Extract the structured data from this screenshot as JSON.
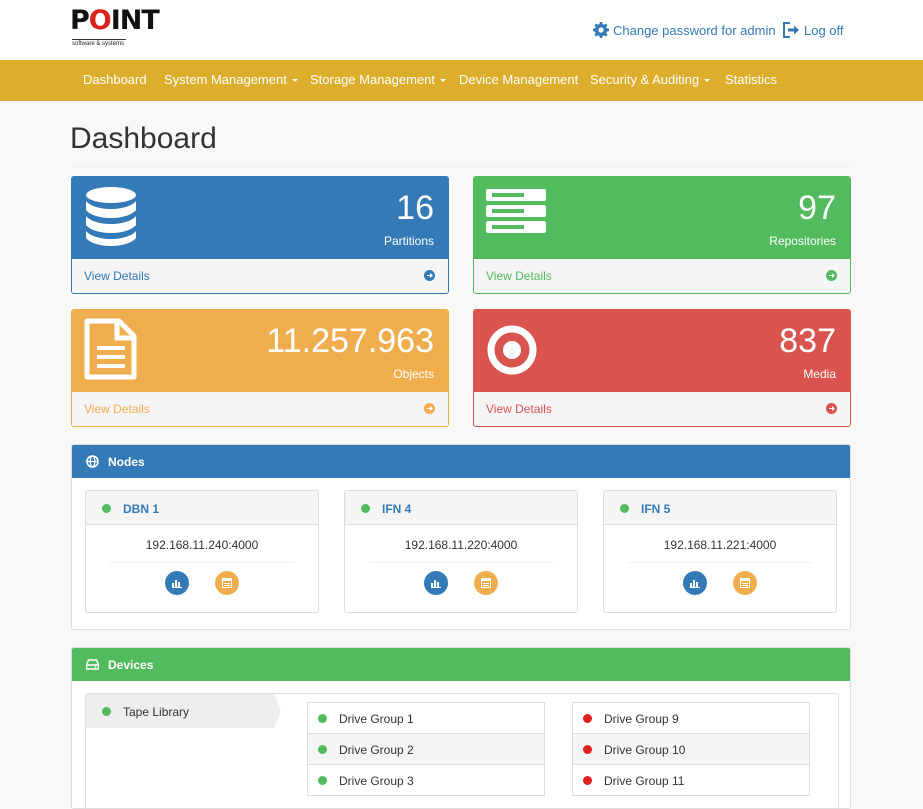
{
  "brand": {
    "logo_text": "POINT",
    "tagline": "software & systems"
  },
  "header": {
    "change_password": "Change password for admin",
    "logout": "Log off"
  },
  "nav": [
    {
      "label": "Dashboard"
    },
    {
      "label": "System Management"
    },
    {
      "label": "Storage Management"
    },
    {
      "label": "Device Management"
    },
    {
      "label": "Security & Auditing"
    },
    {
      "label": "Statistics"
    }
  ],
  "page": {
    "title": "Dashboard"
  },
  "stats": [
    {
      "value": "16",
      "label": "Partitions",
      "link": "View Details",
      "color": "#337ab7",
      "icon": "database-icon"
    },
    {
      "value": "97",
      "label": "Repositories",
      "link": "View Details",
      "color": "#51bb5e",
      "icon": "server-icon"
    },
    {
      "value": "11.257.963",
      "label": "Objects",
      "link": "View Details",
      "color": "#f0ad4e",
      "icon": "document-icon"
    },
    {
      "value": "837",
      "label": "Media",
      "link": "View Details",
      "color": "#d9534f",
      "icon": "target-icon"
    }
  ],
  "nodes_panel": {
    "title": "Nodes",
    "color": "#337ab7",
    "nodes": [
      {
        "name": "DBN 1",
        "address": "192.168.11.240:4000",
        "status": "online"
      },
      {
        "name": "IFN 4",
        "address": "192.168.11.220:4000",
        "status": "online"
      },
      {
        "name": "IFN 5",
        "address": "192.168.11.221:4000",
        "status": "online"
      }
    ]
  },
  "devices_panel": {
    "title": "Devices",
    "color": "#51bb5e",
    "library": {
      "name": "Tape Library",
      "status": "online"
    },
    "groups_left": [
      {
        "name": "Drive Group 1",
        "status": "online"
      },
      {
        "name": "Drive Group 2",
        "status": "online"
      },
      {
        "name": "Drive Group 3",
        "status": "online"
      }
    ],
    "groups_right": [
      {
        "name": "Drive Group 9",
        "status": "offline"
      },
      {
        "name": "Drive Group 10",
        "status": "offline"
      },
      {
        "name": "Drive Group 11",
        "status": "offline"
      }
    ]
  },
  "colors": {
    "online": "#51bb5e",
    "offline": "#e11f1f",
    "nav": "#ddae2b",
    "link": "#337ab7"
  }
}
